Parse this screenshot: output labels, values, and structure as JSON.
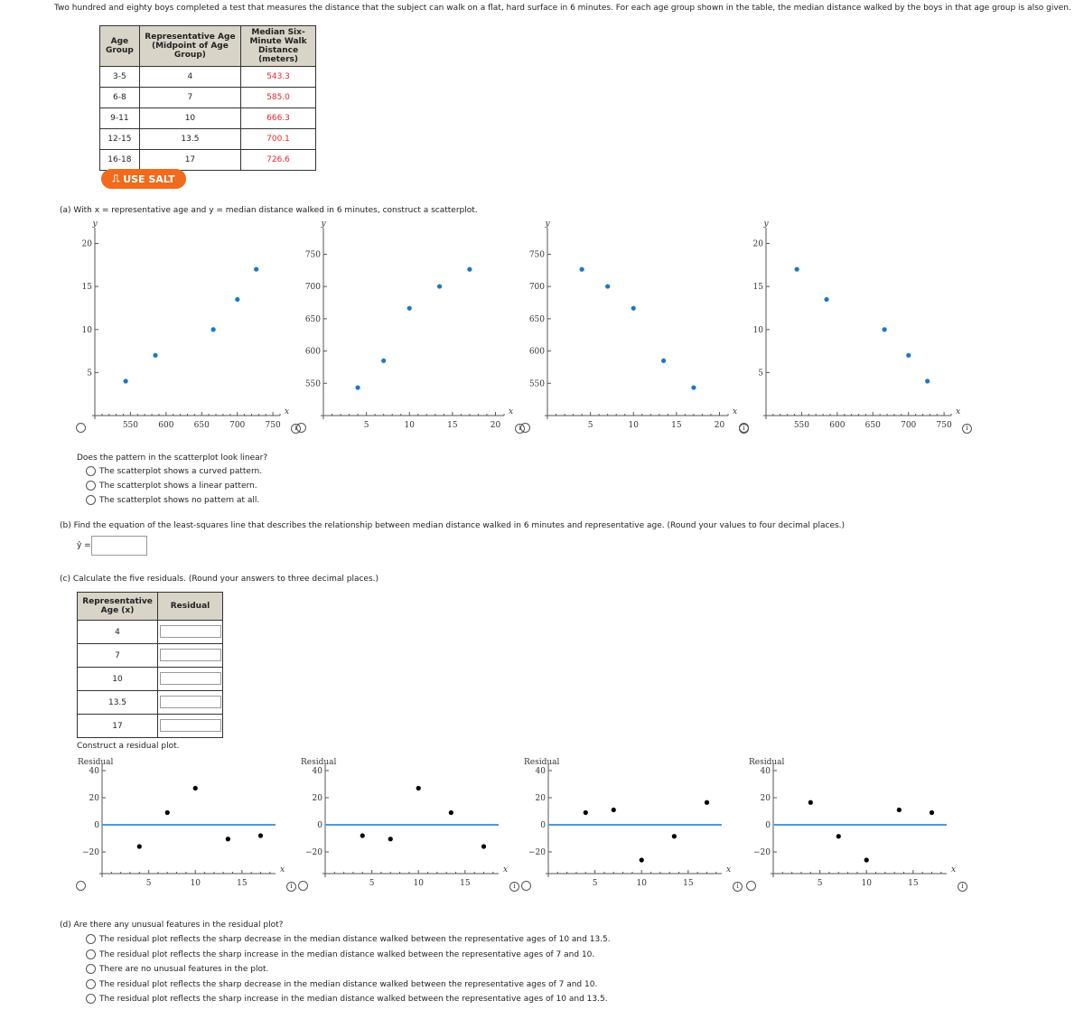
{
  "intro": "Two hundred and eighty boys completed a test that measures the distance that the subject can walk on a flat, hard surface in 6 minutes. For each age group shown in the table, the median distance walked by the boys in that age group is also given.",
  "table": {
    "headers": [
      "Age Group",
      "Representative Age (Midpoint of Age Group)",
      "Median Six-Minute Walk Distance (meters)"
    ],
    "rows": [
      [
        "3-5",
        "4",
        "543.3"
      ],
      [
        "6-8",
        "7",
        "585.0"
      ],
      [
        "9-11",
        "10",
        "666.3"
      ],
      [
        "12-15",
        "13.5",
        "700.1"
      ],
      [
        "16-18",
        "17",
        "726.6"
      ]
    ]
  },
  "salt_label": "USE SALT",
  "part_a": "(a)  With x = representative age and y = median distance walked in 6 minutes, construct a scatterplot.",
  "linear_q": "Does the pattern in the scatterplot look linear?",
  "linear_opts": [
    "The scatterplot shows a curved pattern.",
    "The scatterplot shows a linear pattern.",
    "The scatterplot shows no pattern at all."
  ],
  "part_b": "(b)  Find the equation of the least-squares line that describes the relationship between median distance walked in 6 minutes and representative age. (Round your values to four decimal places.)",
  "yhat_label": "ŷ =",
  "yhat_value": "",
  "part_c": "(c)  Calculate the five residuals. (Round your answers to three decimal places.)",
  "resid_table": {
    "headers": [
      "Representative Age (x)",
      "Residual"
    ],
    "ages": [
      "4",
      "7",
      "10",
      "13.5",
      "17"
    ],
    "values": [
      "",
      "",
      "",
      "",
      ""
    ]
  },
  "resid_plot_prompt": "Construct a residual plot.",
  "part_d": "(d)  Are there any unusual features in the residual plot?",
  "d_opts": [
    "The residual plot reflects the sharp decrease in the median distance walked between the representative ages of 10 and 13.5.",
    "The residual plot reflects the sharp increase in the median distance walked between the representative ages of 7 and 10.",
    "There are no unusual features in the plot.",
    "The residual plot reflects the sharp decrease in the median distance walked between the representative ages of 7 and 10.",
    "The residual plot reflects the sharp increase in the median distance walked between the representative ages of 10 and 13.5."
  ],
  "colors": {
    "point_blue": "#1a78c8",
    "residual_line": "#4f9bd4",
    "table_value": "#e8262e",
    "salt": "#f26a1b"
  },
  "chart_data": [
    {
      "type": "scatter",
      "xlabel": "x",
      "ylabel": "y",
      "xlim": [
        500,
        760
      ],
      "ylim": [
        0,
        21
      ],
      "xticks": [
        550,
        600,
        650,
        700,
        750
      ],
      "yticks": [
        5,
        10,
        15,
        20
      ],
      "x": [
        543.3,
        585,
        666.3,
        700.1,
        726.6
      ],
      "y": [
        4,
        7,
        10,
        13.5,
        17
      ],
      "color": "#1a78c8"
    },
    {
      "type": "scatter",
      "xlabel": "x",
      "ylabel": "y",
      "xlim": [
        0,
        21
      ],
      "ylim": [
        500,
        780
      ],
      "xticks": [
        5,
        10,
        15,
        20
      ],
      "yticks": [
        550,
        600,
        650,
        700,
        750
      ],
      "x": [
        4,
        7,
        10,
        13.5,
        17
      ],
      "y": [
        543.3,
        585,
        666.3,
        700.1,
        726.6
      ],
      "color": "#1a78c8"
    },
    {
      "type": "scatter",
      "xlabel": "x",
      "ylabel": "y",
      "xlim": [
        0,
        21
      ],
      "ylim": [
        500,
        780
      ],
      "xticks": [
        5,
        10,
        15,
        20
      ],
      "yticks": [
        550,
        600,
        650,
        700,
        750
      ],
      "x": [
        4,
        7,
        10,
        13.5,
        17
      ],
      "y": [
        726.6,
        700.1,
        666.3,
        585,
        543.3
      ],
      "color": "#1a78c8"
    },
    {
      "type": "scatter",
      "xlabel": "x",
      "ylabel": "y",
      "xlim": [
        500,
        760
      ],
      "ylim": [
        0,
        21
      ],
      "xticks": [
        550,
        600,
        650,
        700,
        750
      ],
      "yticks": [
        5,
        10,
        15,
        20
      ],
      "x": [
        543.3,
        585,
        666.3,
        700.1,
        726.6
      ],
      "y": [
        17,
        13.5,
        10,
        7,
        4
      ],
      "color": "#1a78c8"
    },
    {
      "type": "scatter",
      "xlabel": "x",
      "ylabel": "Residual",
      "xlim": [
        0,
        18.6
      ],
      "ylim": [
        -36,
        40
      ],
      "xticks": [
        5,
        10,
        15
      ],
      "yticks": [
        -20,
        0,
        20,
        40
      ],
      "x": [
        4,
        7,
        10,
        13.5,
        17
      ],
      "y": [
        -16,
        9,
        27,
        -10.5,
        -8
      ],
      "color": "#000000"
    },
    {
      "type": "scatter",
      "xlabel": "x",
      "ylabel": "Residual",
      "xlim": [
        0,
        18.6
      ],
      "ylim": [
        -36,
        40
      ],
      "xticks": [
        5,
        10,
        15
      ],
      "yticks": [
        -20,
        0,
        20,
        40
      ],
      "x": [
        4,
        7,
        10,
        13.5,
        17
      ],
      "y": [
        -8,
        -10.5,
        27,
        9,
        -16
      ],
      "color": "#000000"
    },
    {
      "type": "scatter",
      "xlabel": "x",
      "ylabel": "Residual",
      "xlim": [
        0,
        18.6
      ],
      "ylim": [
        -36,
        40
      ],
      "xticks": [
        5,
        10,
        15
      ],
      "yticks": [
        -20,
        0,
        20,
        40
      ],
      "x": [
        4,
        7,
        10,
        13.5,
        17
      ],
      "y": [
        9,
        11,
        -26,
        -8.5,
        16.5
      ],
      "color": "#000000"
    },
    {
      "type": "scatter",
      "xlabel": "x",
      "ylabel": "Residual",
      "xlim": [
        0,
        18.6
      ],
      "ylim": [
        -36,
        40
      ],
      "xticks": [
        5,
        10,
        15
      ],
      "yticks": [
        -20,
        0,
        20,
        40
      ],
      "x": [
        4,
        7,
        10,
        13.5,
        17
      ],
      "y": [
        16.5,
        -8.5,
        -26,
        11,
        9
      ],
      "color": "#000000"
    }
  ]
}
